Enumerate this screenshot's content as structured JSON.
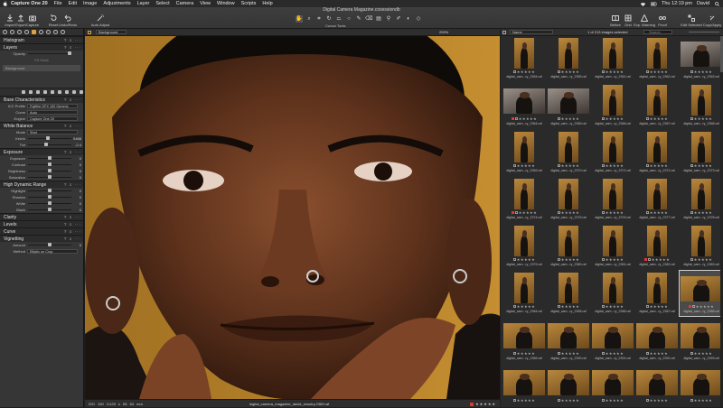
{
  "menubar": {
    "items": [
      "Capture One 20",
      "File",
      "Edit",
      "Image",
      "Adjustments",
      "Layer",
      "Select",
      "Camera",
      "View",
      "Window",
      "Scripts",
      "Help"
    ],
    "user": "David",
    "clock": "Thu 12:19 pm"
  },
  "toolbar": {
    "window_title": "Digital Camera Magazine.cosessiondb",
    "import": "Import",
    "export": "Export",
    "capture": "Capture",
    "reset": "Reset",
    "undo_redo": "Undo/Redo",
    "auto_adjust": "Auto Adjust",
    "cursor_tools": "Cursor Tools",
    "before": "Before",
    "grid": "Grid",
    "exp_warning": "Exp. Warning",
    "proof": "Proof",
    "edit_selected": "Edit Selected",
    "copy_apply": "Copy/Apply"
  },
  "left_panel": {
    "sections": {
      "histogram": "Histogram",
      "layers": "Layers",
      "base": "Base Characteristics",
      "white_balance": "White Balance",
      "exposure": "Exposure",
      "hdr": "High Dynamic Range",
      "clarity": "Clarity",
      "levels": "Levels",
      "curve": "Curve",
      "vignetting": "Vignetting"
    },
    "layers": {
      "opacity_label": "Opacity",
      "fill_mask": "Fill Mask",
      "background": "Background"
    },
    "base": [
      {
        "label": "ICC Profile",
        "value": "Fujifilm GFX 100 Generic"
      },
      {
        "label": "Curve",
        "value": "Auto"
      },
      {
        "label": "Engine",
        "value": "Capture One 20"
      }
    ],
    "white_balance": [
      {
        "label": "Mode",
        "value": "Shot",
        "type": "dd"
      },
      {
        "label": "Kelvin",
        "value": "5488",
        "type": "slider",
        "pos": 0.45
      },
      {
        "label": "Tint",
        "value": "-2.4",
        "type": "slider",
        "pos": 0.4
      }
    ],
    "exposure": [
      {
        "label": "Exposure",
        "value": "0",
        "pos": 0.5
      },
      {
        "label": "Contrast",
        "value": "0",
        "pos": 0.5
      },
      {
        "label": "Brightness",
        "value": "0",
        "pos": 0.5
      },
      {
        "label": "Saturation",
        "value": "0",
        "pos": 0.5
      }
    ],
    "hdr": [
      {
        "label": "Highlight",
        "value": "0",
        "pos": 0.5
      },
      {
        "label": "Shadow",
        "value": "0",
        "pos": 0.5
      },
      {
        "label": "White",
        "value": "0",
        "pos": 0.5
      },
      {
        "label": "Black",
        "value": "0",
        "pos": 0.5
      }
    ],
    "vignetting": [
      {
        "label": "Amount",
        "value": "0",
        "type": "slider",
        "pos": 0.5
      },
      {
        "label": "Method",
        "value": "Elliptic on Crop",
        "type": "dd"
      }
    ]
  },
  "viewer": {
    "background_label": "Background",
    "zoom": "200%",
    "meta": "ISO 100   1/125 s   f/8   63 mm",
    "filename": "digital_camera_magazine_david_shoutry.2369.raf",
    "rating": "★★★★★"
  },
  "browser": {
    "sort_label": "Name",
    "count": "1 of 213 images selected",
    "search_placeholder": "Search",
    "thumbnails": [
      {
        "name": "digital_cam...ry_2354.raf",
        "kind": "tall"
      },
      {
        "name": "digital_cam...ry_2355.raf",
        "kind": "tall"
      },
      {
        "name": "digital_cam...ry_2361.raf",
        "kind": "tall"
      },
      {
        "name": "digital_cam...ry_2362.raf",
        "kind": "tall"
      },
      {
        "name": "digital_cam...ry_2363.raf",
        "kind": "wide"
      },
      {
        "name": "digital_cam...ry_2364.raf",
        "kind": "wide",
        "red": true
      },
      {
        "name": "digital_cam...ry_2365.raf",
        "kind": "wide"
      },
      {
        "name": "digital_cam...ry_2366.raf",
        "kind": "tall"
      },
      {
        "name": "digital_cam...ry_2367.raf",
        "kind": "tall"
      },
      {
        "name": "digital_cam...ry_2368.raf",
        "kind": "tall"
      },
      {
        "name": "digital_cam...ry_2369.raf",
        "kind": "tall"
      },
      {
        "name": "digital_cam...ry_2370.raf",
        "kind": "tall"
      },
      {
        "name": "digital_cam...ry_2371.raf",
        "kind": "tall"
      },
      {
        "name": "digital_cam...ry_2372.raf",
        "kind": "tall"
      },
      {
        "name": "digital_cam...ry_2373.raf",
        "kind": "tall"
      },
      {
        "name": "digital_cam...ry_2374.raf",
        "kind": "tall",
        "red": true
      },
      {
        "name": "digital_cam...ry_2375.raf",
        "kind": "tall"
      },
      {
        "name": "digital_cam...ry_2376.raf",
        "kind": "tall"
      },
      {
        "name": "digital_cam...ry_2377.raf",
        "kind": "tall"
      },
      {
        "name": "digital_cam...ry_2378.raf",
        "kind": "tall"
      },
      {
        "name": "digital_cam...ry_2379.raf",
        "kind": "tall"
      },
      {
        "name": "digital_cam...ry_2380.raf",
        "kind": "tall"
      },
      {
        "name": "digital_cam...ry_2381.raf",
        "kind": "tall"
      },
      {
        "name": "digital_cam...ry_2382.raf",
        "kind": "tall",
        "red": true
      },
      {
        "name": "digital_cam...ry_2383.raf",
        "kind": "tall"
      },
      {
        "name": "digital_cam...ry_2384.raf",
        "kind": "tall"
      },
      {
        "name": "digital_cam...ry_2385.raf",
        "kind": "tall"
      },
      {
        "name": "digital_cam...ry_2386.raf",
        "kind": "tall"
      },
      {
        "name": "digital_cam...ry_2387.raf",
        "kind": "tall"
      },
      {
        "name": "digital_cam...ry_2388.raf",
        "kind": "wide",
        "selected": true,
        "red": true
      },
      {
        "name": "digital_cam...ry_2389.raf",
        "kind": "wide"
      },
      {
        "name": "digital_cam...ry_2390.raf",
        "kind": "wide"
      },
      {
        "name": "digital_cam...ry_2391.raf",
        "kind": "wide"
      },
      {
        "name": "digital_cam...ry_2392.raf",
        "kind": "wide"
      },
      {
        "name": "digital_cam...ry_2393.raf",
        "kind": "wide"
      },
      {
        "name": "",
        "kind": "wide"
      },
      {
        "name": "",
        "kind": "wide"
      },
      {
        "name": "",
        "kind": "wide"
      },
      {
        "name": "",
        "kind": "wide"
      },
      {
        "name": "",
        "kind": "wide"
      }
    ]
  },
  "colors": {
    "accent": "#e1a23e",
    "red_tag": "#e2382e",
    "panel": "#363636"
  }
}
